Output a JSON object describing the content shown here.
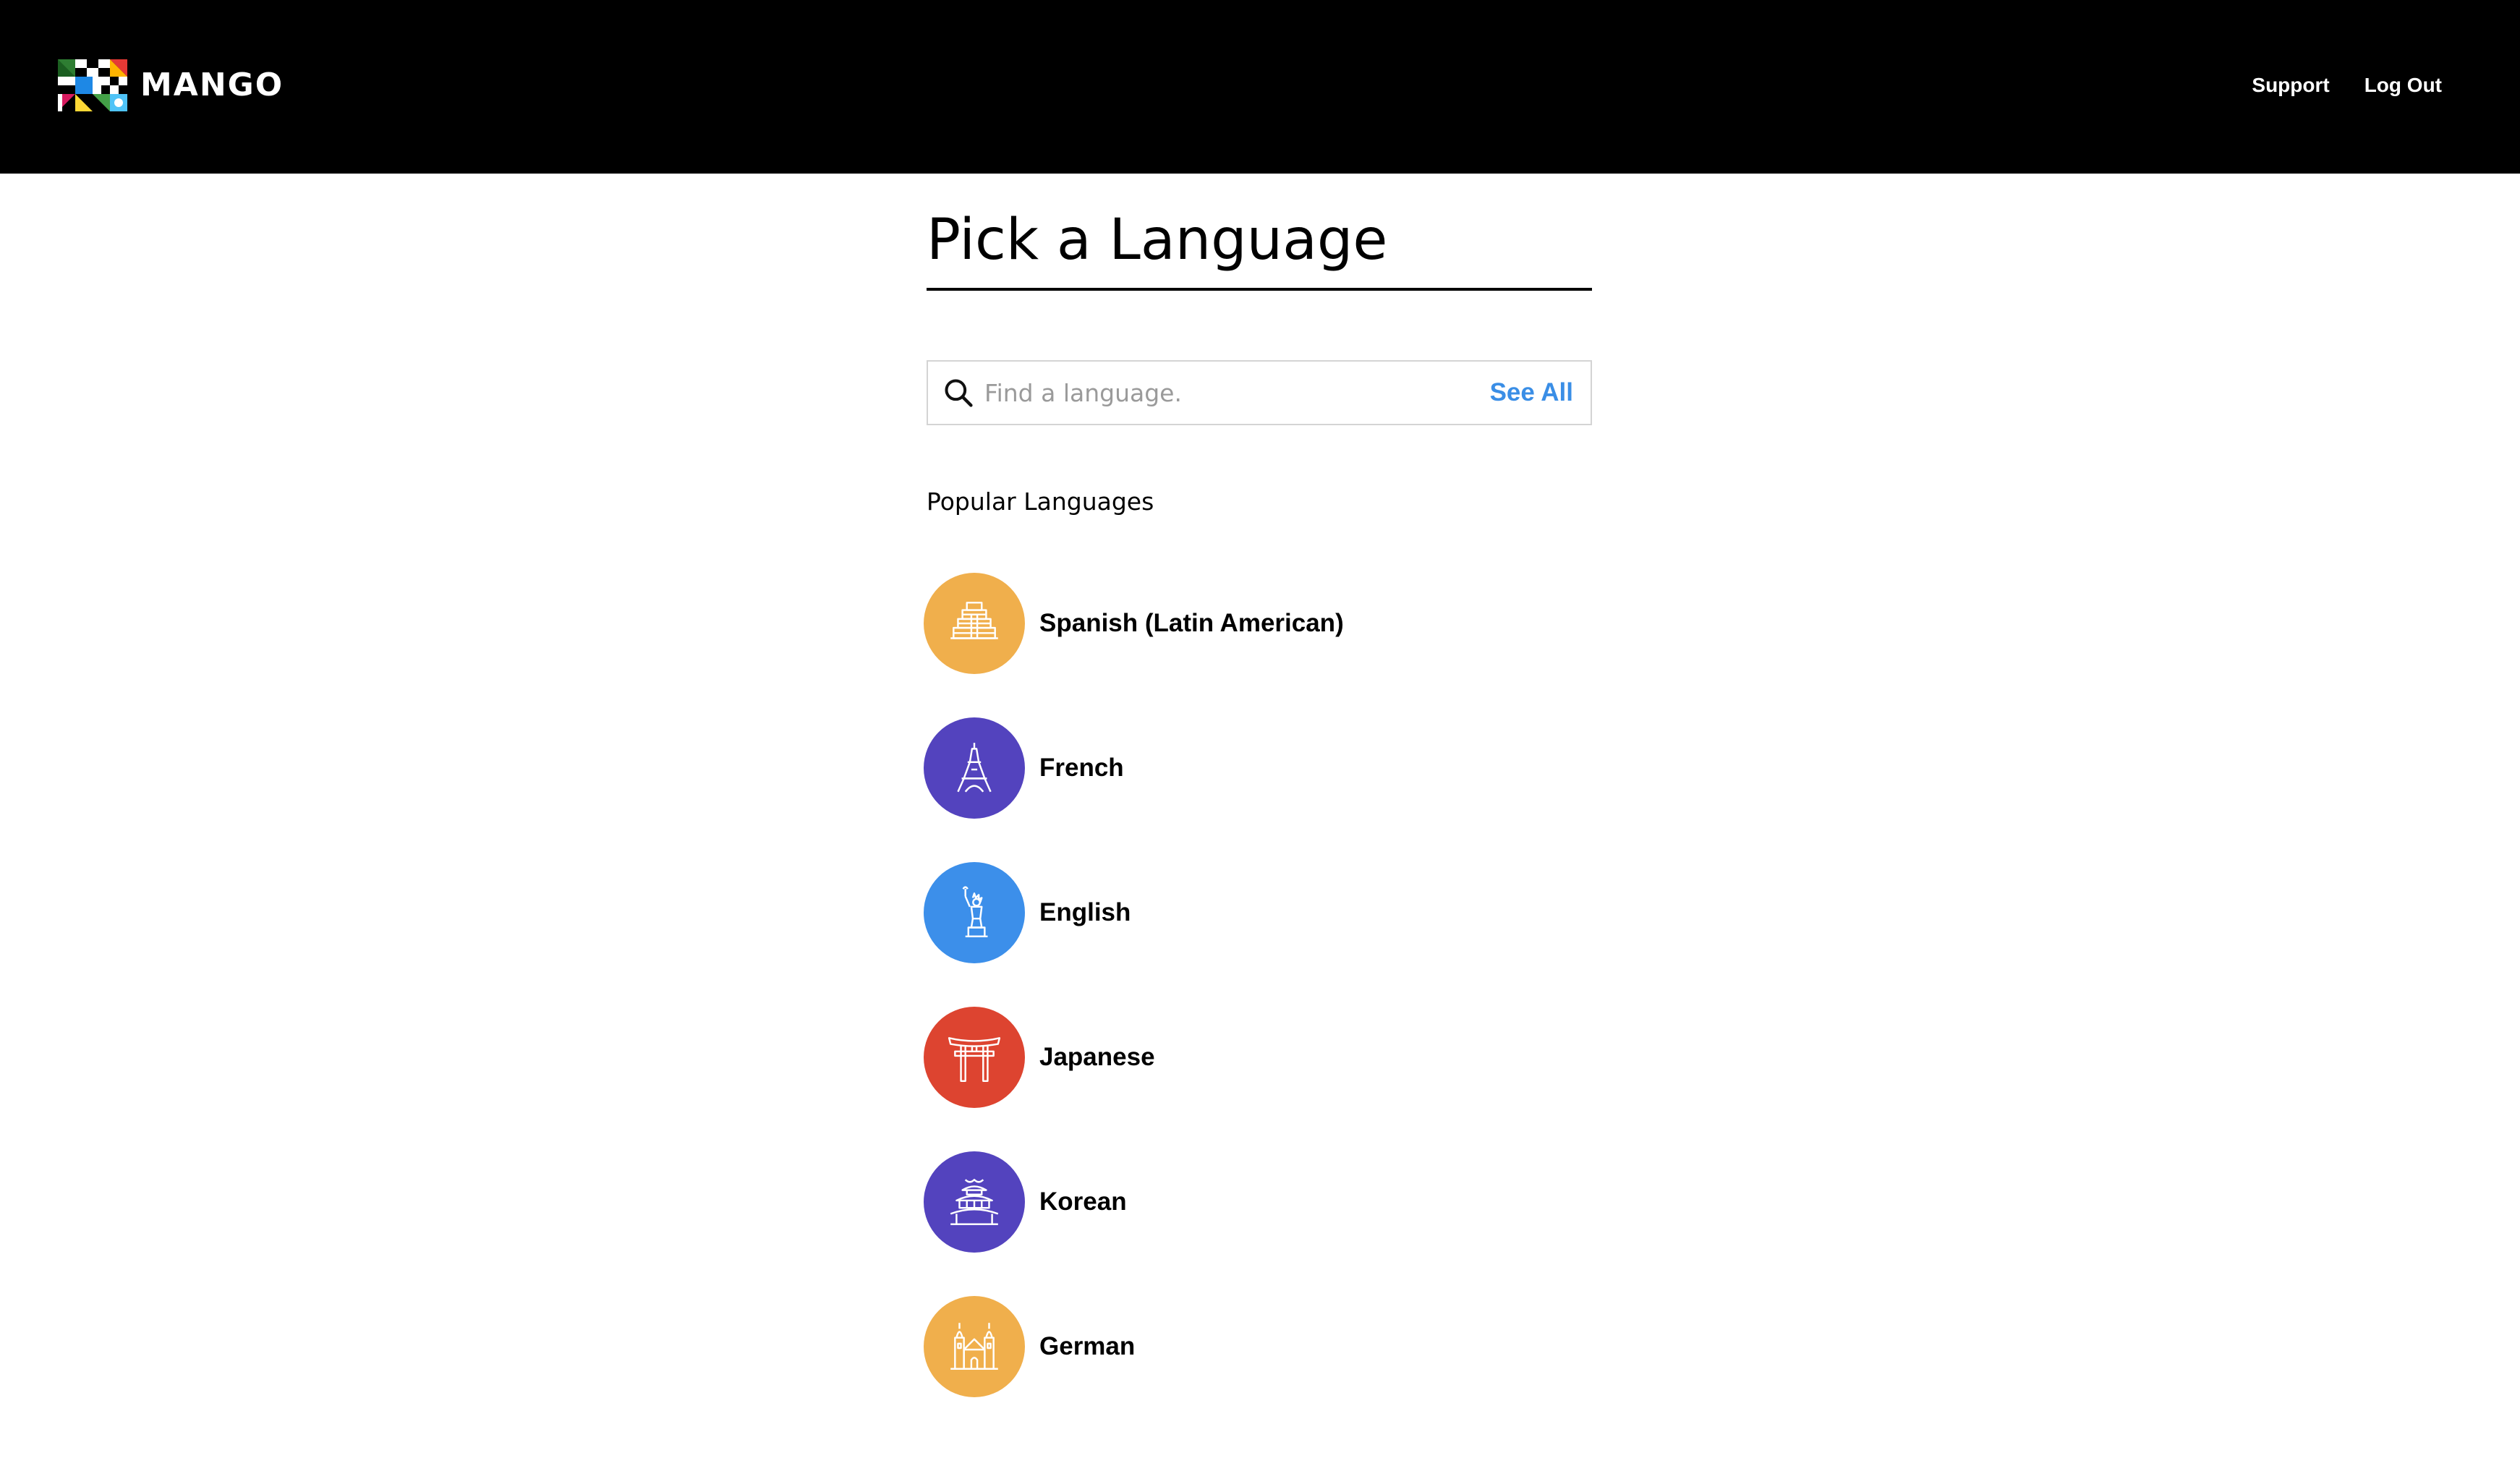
{
  "header": {
    "brand_name": "MANGO",
    "nav": [
      {
        "label": "Support"
      },
      {
        "label": "Log Out"
      }
    ]
  },
  "main": {
    "title": "Pick a Language",
    "search": {
      "placeholder": "Find a language.",
      "value": "",
      "see_all_label": "See All"
    },
    "popular_heading": "Popular Languages",
    "languages": [
      {
        "name": "Spanish (Latin American)",
        "color": "#F0AF4C",
        "icon": "pyramid-icon"
      },
      {
        "name": "French",
        "color": "#5343BE",
        "icon": "eiffel-tower-icon"
      },
      {
        "name": "English",
        "color": "#3C8FEA",
        "icon": "statue-of-liberty-icon"
      },
      {
        "name": "Japanese",
        "color": "#DD4430",
        "icon": "torii-gate-icon"
      },
      {
        "name": "Korean",
        "color": "#5343BE",
        "icon": "pagoda-icon"
      },
      {
        "name": "German",
        "color": "#F0AF4C",
        "icon": "castle-icon"
      }
    ]
  }
}
